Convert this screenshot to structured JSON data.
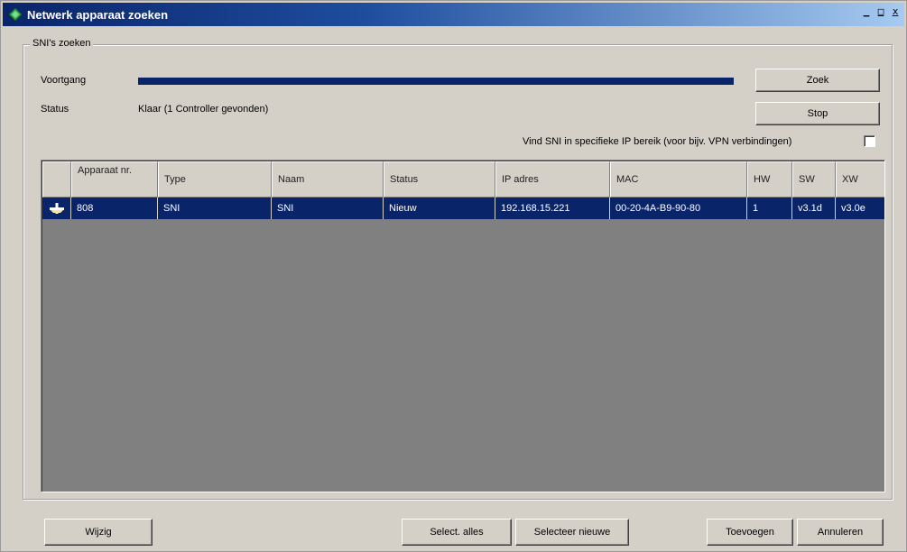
{
  "window": {
    "title": "Netwerk apparaat zoeken",
    "controls": {
      "minimize": "_",
      "maximize": "□",
      "close": "x"
    }
  },
  "group": {
    "legend": "SNI's zoeken",
    "progress_label": "Voortgang",
    "progress_value": 1.0,
    "status_label": "Status",
    "status_value": "Klaar (1 Controller  gevonden)",
    "search_button": "Zoek",
    "stop_button": "Stop",
    "ip_range_label": "Vind SNI in specifieke IP bereik (voor bijv. VPN verbindingen)",
    "ip_range_checked": false
  },
  "table": {
    "columns": [
      "",
      "Apparaat nr.",
      "Type",
      "Naam",
      "Status",
      "IP adres",
      "MAC",
      "HW",
      "SW",
      "XW"
    ],
    "rows": [
      {
        "marker_icon": "row-pointer-icon",
        "cells": [
          "808",
          "SNI",
          "SNI",
          "Nieuw",
          "192.168.15.221",
          "00-20-4A-B9-90-80",
          "1",
          "v3.1d",
          "v3.0e"
        ]
      }
    ]
  },
  "footer": {
    "edit_button": "Wijzig",
    "select_all_button": "Select. alles",
    "select_new_button": "Selecteer nieuwe",
    "add_button": "Toevoegen",
    "cancel_button": "Annuleren"
  },
  "colors": {
    "accent": "#0a246a",
    "face": "#d4d0c8",
    "grid_background": "#808080",
    "app_icon": "#2fa84f"
  }
}
